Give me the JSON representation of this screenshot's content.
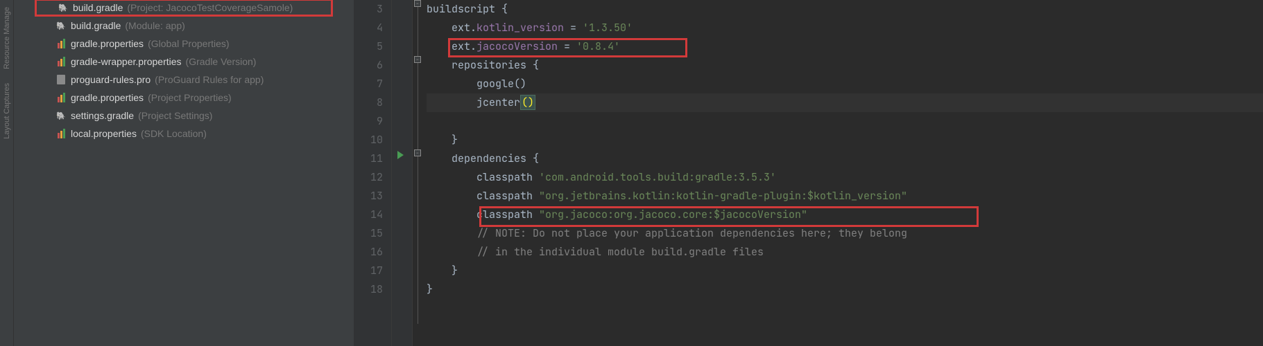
{
  "sidebar_strip": {
    "label_top": "Resource Manage",
    "label_bottom": "Layout Captures"
  },
  "tree": [
    {
      "icon": "elephant",
      "name": "build.gradle",
      "desc": "(Project: JacocoTestCoverageSamole)",
      "highlighted": true
    },
    {
      "icon": "elephant",
      "name": "build.gradle",
      "desc": "(Module: app)"
    },
    {
      "icon": "bars",
      "name": "gradle.properties",
      "desc": "(Global Properties)"
    },
    {
      "icon": "bars",
      "name": "gradle-wrapper.properties",
      "desc": "(Gradle Version)"
    },
    {
      "icon": "doc",
      "name": "proguard-rules.pro",
      "desc": "(ProGuard Rules for app)"
    },
    {
      "icon": "bars",
      "name": "gradle.properties",
      "desc": "(Project Properties)"
    },
    {
      "icon": "elephant",
      "name": "settings.gradle",
      "desc": "(Project Settings)"
    },
    {
      "icon": "bars",
      "name": "local.properties",
      "desc": "(SDK Location)"
    }
  ],
  "line_numbers": [
    "3",
    "4",
    "5",
    "6",
    "7",
    "8",
    "9",
    "10",
    "11",
    "12",
    "13",
    "14",
    "15",
    "16",
    "17",
    "18"
  ],
  "code": {
    "l3_a": "buildscript ",
    "l3_b": "{",
    "l4_a": "    ext.",
    "l4_b": "kotlin_version",
    "l4_c": " = ",
    "l4_d": "'1.3.50'",
    "l5_a": "    ext.",
    "l5_b": "jacocoVersion",
    "l5_c": " = ",
    "l5_d": "'0.8.4'",
    "l6_a": "    repositories ",
    "l6_b": "{",
    "l7_a": "        google()",
    "l8_a": "        jcenter",
    "l8_b": "()",
    "l9_a": "",
    "l10_a": "    }",
    "l11_a": "    dependencies ",
    "l11_b": "{",
    "l12_a": "        classpath ",
    "l12_b": "'com.android.tools.build:gradle:3.5.3'",
    "l13_a": "        classpath ",
    "l13_b": "\"org.jetbrains.kotlin:kotlin-gradle-plugin:",
    "l13_c": "$kotlin_version",
    "l13_d": "\"",
    "l14_a": "        classpath ",
    "l14_b": "\"org.jacoco:org.jacoco.core:",
    "l14_c": "$jacocoVersion",
    "l14_d": "\"",
    "l15_a": "        // NOTE: Do not place your application dependencies here; they belong",
    "l16_a": "        // in the individual module build.gradle files",
    "l17_a": "    }",
    "l18_a": "}"
  }
}
